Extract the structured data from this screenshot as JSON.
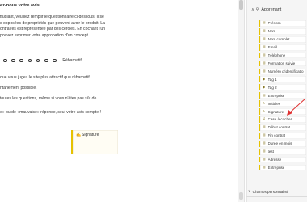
{
  "document": {
    "title": "ez-nous votre avis",
    "intro_lines": [
      "ttudiant, veuillez remplir le questionnaire ci-dessous. Il se",
      "s opposées de propriétés que peuvent avoir le produit. La",
      "ontraires est représentée par des cercles. En cochant l'un",
      "pouvez exprimer votre approbation d'un concept."
    ],
    "scale_label": "Rébarbatif",
    "lines": [
      "que vous jugez le site plus attractif que rébarbatif.",
      "ntanément possible.",
      "toutes les questions, même si vous n'êtes pas sûr de",
      "e» ou de «mauvaise» réponse, seul votre avis compte !"
    ],
    "signature_field": {
      "label": "Signature",
      "icon": "pen-icon"
    }
  },
  "panel": {
    "title": "Apprenant",
    "fields": [
      {
        "label": "Prénom",
        "icon": "text-icon"
      },
      {
        "label": "Nom",
        "icon": "text-icon"
      },
      {
        "label": "Nom complet",
        "icon": "text-icon"
      },
      {
        "label": "Email",
        "icon": "text-icon"
      },
      {
        "label": "Téléphone",
        "icon": "text-icon"
      },
      {
        "label": "Formation suivie",
        "icon": "text-icon"
      },
      {
        "label": "Numéro d'identificatio",
        "icon": "text-icon"
      },
      {
        "label": "Tag 1",
        "icon": "tag-icon"
      },
      {
        "label": "Tag 2",
        "icon": "tag-icon"
      },
      {
        "label": "Entreprise",
        "icon": "text-icon"
      },
      {
        "label": "Initiales",
        "icon": "pen-icon"
      },
      {
        "label": "Signature",
        "icon": "pen-icon"
      },
      {
        "label": "Case à cocher",
        "icon": "checkbox-icon"
      },
      {
        "label": "Début contrat",
        "icon": "text-icon"
      },
      {
        "label": "Fin contrat",
        "icon": "text-icon"
      },
      {
        "label": "Durée en mois",
        "icon": "text-icon"
      },
      {
        "label": "test",
        "icon": "text-icon"
      },
      {
        "label": "Adresse",
        "icon": "text-icon"
      },
      {
        "label": "Entreprise",
        "icon": "text-icon"
      }
    ],
    "custom_fields_label": "Champs personnalisé"
  },
  "colors": {
    "accent": "#e6c200",
    "annotation_arrow": "#e03030"
  }
}
